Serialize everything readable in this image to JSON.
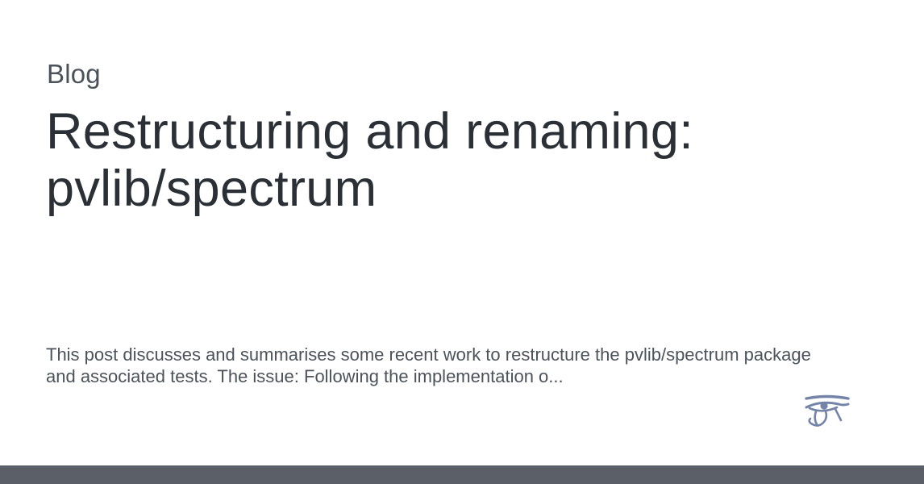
{
  "card": {
    "section_label": "Blog",
    "title": "Restructuring and renaming: pvlib/spectrum",
    "excerpt": "This post discusses and summarises some recent work to restructure the pvlib/spectrum package and associated tests. The issue: Following the implementation o...",
    "logo_icon": "eye-of-horus-icon",
    "logo_color": "#7483a8"
  },
  "footer": {
    "bar_color": "#5a5f68"
  }
}
